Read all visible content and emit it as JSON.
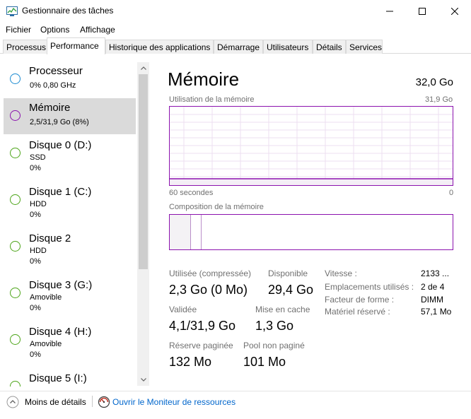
{
  "window": {
    "title": "Gestionnaire des tâches"
  },
  "menu": [
    "Fichier",
    "Options",
    "Affichage"
  ],
  "tabs": [
    "Processus",
    "Performance",
    "Historique des applications",
    "Démarrage",
    "Utilisateurs",
    "Détails",
    "Services"
  ],
  "active_tab": "Performance",
  "sidebar": {
    "items": [
      {
        "title": "Processeur",
        "line1": "0% 0,80 GHz",
        "line2": "",
        "color": "#1a8ad1"
      },
      {
        "title": "Mémoire",
        "line1": "2,5/31,9 Go (8%)",
        "line2": "",
        "color": "#8b12ae"
      },
      {
        "title": "Disque 0 (D:)",
        "line1": "SSD",
        "line2": "0%",
        "color": "#4ca418"
      },
      {
        "title": "Disque 1 (C:)",
        "line1": "HDD",
        "line2": "0%",
        "color": "#4ca418"
      },
      {
        "title": "Disque 2",
        "line1": "HDD",
        "line2": "0%",
        "color": "#4ca418"
      },
      {
        "title": "Disque 3 (G:)",
        "line1": "Amovible",
        "line2": "0%",
        "color": "#4ca418"
      },
      {
        "title": "Disque 4 (H:)",
        "line1": "Amovible",
        "line2": "0%",
        "color": "#4ca418"
      },
      {
        "title": "Disque 5 (I:)",
        "line1": "",
        "line2": "",
        "color": "#4ca418"
      }
    ]
  },
  "main": {
    "title": "Mémoire",
    "total": "32,0 Go",
    "usage_label": "Utilisation de la mémoire",
    "usage_max": "31,9 Go",
    "time_label": "60 secondes",
    "time_end": "0",
    "composition_label": "Composition de la mémoire",
    "stats": {
      "used_label": "Utilisée (compressée)",
      "used_value": "2,3 Go (0 Mo)",
      "available_label": "Disponible",
      "available_value": "29,4 Go",
      "committed_label": "Validée",
      "committed_value": "4,1/31,9 Go",
      "cached_label": "Mise en cache",
      "cached_value": "1,3 Go",
      "paged_label": "Réserve paginée",
      "paged_value": "132 Mo",
      "nonpaged_label": "Pool non paginé",
      "nonpaged_value": "101 Mo"
    },
    "props": {
      "speed_label": "Vitesse :",
      "speed_value": "2133 ...",
      "slots_label": "Emplacements utilisés :",
      "slots_value": "2 de 4",
      "form_label": "Facteur de forme :",
      "form_value": "DIMM",
      "reserved_label": "Matériel réservé :",
      "reserved_value": "57,1 Mo"
    }
  },
  "footer": {
    "less_details": "Moins de détails",
    "open_monitor": "Ouvrir le Moniteur de ressources"
  },
  "colors": {
    "memory_accent": "#8b12ae",
    "cpu_accent": "#1a8ad1",
    "disk_accent": "#4ca418",
    "link": "#0066cc"
  }
}
